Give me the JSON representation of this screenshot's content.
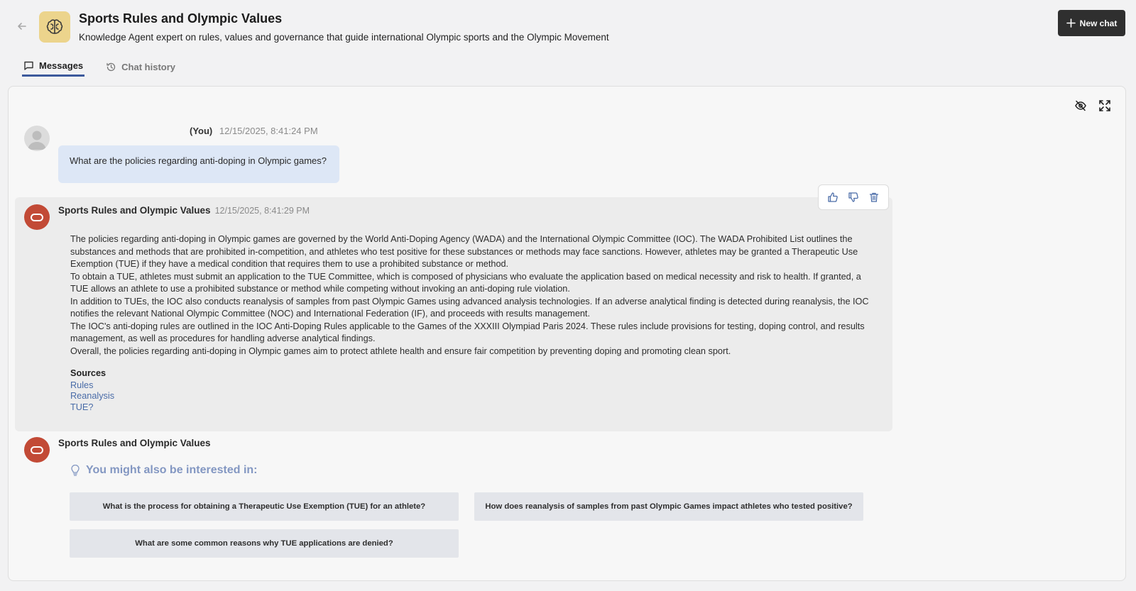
{
  "header": {
    "title": "Sports Rules and Olympic Values",
    "subtitle": "Knowledge Agent expert on rules, values and governance that guide international Olympic sports and the Olympic Movement",
    "new_chat_label": "New chat",
    "icon": "brain-icon",
    "icon_bg": "#ecd48c"
  },
  "tabs": [
    {
      "label": "Messages",
      "icon": "message-icon",
      "active": true
    },
    {
      "label": "Chat history",
      "icon": "history-icon",
      "active": false
    }
  ],
  "panel_tools": [
    "eye-off-icon",
    "expand-icon"
  ],
  "user_message": {
    "author": "(You)",
    "timestamp": "12/15/2025, 8:41:24 PM",
    "text": "What are the policies regarding anti-doping in Olympic games?"
  },
  "bot_message": {
    "author": "Sports Rules and Olympic Values",
    "timestamp": "12/15/2025, 8:41:29 PM",
    "actions": [
      "thumbs-up-icon",
      "thumbs-down-icon",
      "trash-icon"
    ],
    "paragraphs": [
      "The policies regarding anti-doping in Olympic games are governed by the World Anti-Doping Agency (WADA) and the International Olympic Committee (IOC). The WADA Prohibited List outlines the substances and methods that are prohibited in-competition, and athletes who test positive for these substances or methods may face sanctions. However, athletes may be granted a Therapeutic Use Exemption (TUE) if they have a medical condition that requires them to use a prohibited substance or method.",
      "To obtain a TUE, athletes must submit an application to the TUE Committee, which is composed of physicians who evaluate the application based on medical necessity and risk to health. If granted, a TUE allows an athlete to use a prohibited substance or method while competing without invoking an anti-doping rule violation.",
      "In addition to TUEs, the IOC also conducts reanalysis of samples from past Olympic Games using advanced analysis technologies. If an adverse analytical finding is detected during reanalysis, the IOC notifies the relevant National Olympic Committee (NOC) and International Federation (IF), and proceeds with results management.",
      "The IOC's anti-doping rules are outlined in the IOC Anti-Doping Rules applicable to the Games of the XXXIII Olympiad Paris 2024. These rules include provisions for testing, doping control, and results management, as well as procedures for handling adverse analytical findings.",
      "Overall, the policies regarding anti-doping in Olympic games aim to protect athlete health and ensure fair competition by preventing doping and promoting clean sport."
    ],
    "sources_heading": "Sources",
    "sources": [
      "Rules",
      "Reanalysis",
      "TUE?"
    ]
  },
  "suggestions": {
    "author": "Sports Rules and Olympic Values",
    "title": "You might also be interested in:",
    "icon": "lightbulb-icon",
    "items": [
      "What is the process for obtaining a Therapeutic Use Exemption (TUE) for an athlete?",
      "How does reanalysis of samples from past Olympic Games impact athletes who tested positive?",
      "What are some common reasons why TUE applications are denied?"
    ]
  },
  "colors": {
    "accent": "#3d5a9c",
    "bot_avatar": "#c24a36",
    "user_bubble": "#dde7f6",
    "link": "#4a6ca8",
    "suggest_title": "#8397c2"
  }
}
